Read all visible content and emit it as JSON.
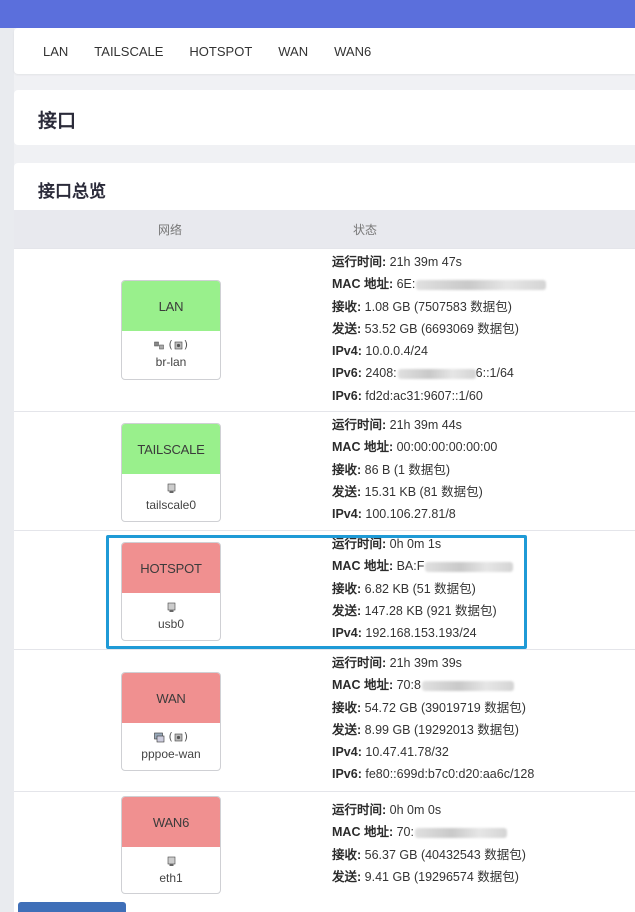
{
  "tabs": [
    "LAN",
    "TAILSCALE",
    "HOTSPOT",
    "WAN",
    "WAN6"
  ],
  "page": {
    "title": "接口"
  },
  "section": {
    "title": "接口总览",
    "col_network": "网络",
    "col_status": "状态"
  },
  "colors": {
    "green": "#99f08c",
    "red": "#f09090",
    "accent": "#5b6fdc",
    "highlight": "#1f9ad6"
  },
  "interfaces": [
    {
      "name": "LAN",
      "device": "br-lan",
      "icons": "bridge+wifi",
      "lines": [
        {
          "k": "运行时间:",
          "v": "21h 39m 47s"
        },
        {
          "k": "MAC 地址:",
          "v": "6E:"
        },
        {
          "k": "接收:",
          "v": "1.08 GB (7507583 数据包)"
        },
        {
          "k": "发送:",
          "v": "53.52 GB (6693069 数据包)"
        },
        {
          "k": "IPv4:",
          "v": "10.0.0.4/24"
        },
        {
          "k": "IPv6:",
          "v": "2408:"
        },
        {
          "k": "IPv6:",
          "v": "fd2d:ac31:9607::1/60"
        }
      ],
      "ipv6_suffix": "6::1/64"
    },
    {
      "name": "TAILSCALE",
      "device": "tailscale0",
      "icons": "ethernet",
      "lines": [
        {
          "k": "运行时间:",
          "v": "21h 39m 44s"
        },
        {
          "k": "MAC 地址:",
          "v": "00:00:00:00:00:00"
        },
        {
          "k": "接收:",
          "v": "86 B (1 数据包)"
        },
        {
          "k": "发送:",
          "v": "15.31 KB (81 数据包)"
        },
        {
          "k": "IPv4:",
          "v": "100.106.27.81/8"
        }
      ]
    },
    {
      "name": "HOTSPOT",
      "device": "usb0",
      "icons": "ethernet",
      "lines": [
        {
          "k": "运行时间:",
          "v": "0h 0m 1s"
        },
        {
          "k": "MAC 地址:",
          "v": "BA:F"
        },
        {
          "k": "接收:",
          "v": "6.82 KB (51 数据包)"
        },
        {
          "k": "发送:",
          "v": "147.28 KB (921 数据包)"
        },
        {
          "k": "IPv4:",
          "v": "192.168.153.193/24"
        }
      ]
    },
    {
      "name": "WAN",
      "device": "pppoe-wan",
      "icons": "pppoe+wifi",
      "lines": [
        {
          "k": "运行时间:",
          "v": "21h 39m 39s"
        },
        {
          "k": "MAC 地址:",
          "v": "70:8"
        },
        {
          "k": "接收:",
          "v": "54.72 GB (39019719 数据包)"
        },
        {
          "k": "发送:",
          "v": "8.99 GB (19292013 数据包)"
        },
        {
          "k": "IPv4:",
          "v": "10.47.41.78/32"
        },
        {
          "k": "IPv6:",
          "v": "fe80::699d:b7c0:d20:aa6c/128"
        }
      ]
    },
    {
      "name": "WAN6",
      "device": "eth1",
      "icons": "ethernet",
      "lines": [
        {
          "k": "运行时间:",
          "v": "0h 0m 0s"
        },
        {
          "k": "MAC 地址:",
          "v": "70:"
        },
        {
          "k": "接收:",
          "v": "56.37 GB (40432543 数据包)"
        },
        {
          "k": "发送:",
          "v": "9.41 GB (19296574 数据包)"
        }
      ]
    }
  ]
}
